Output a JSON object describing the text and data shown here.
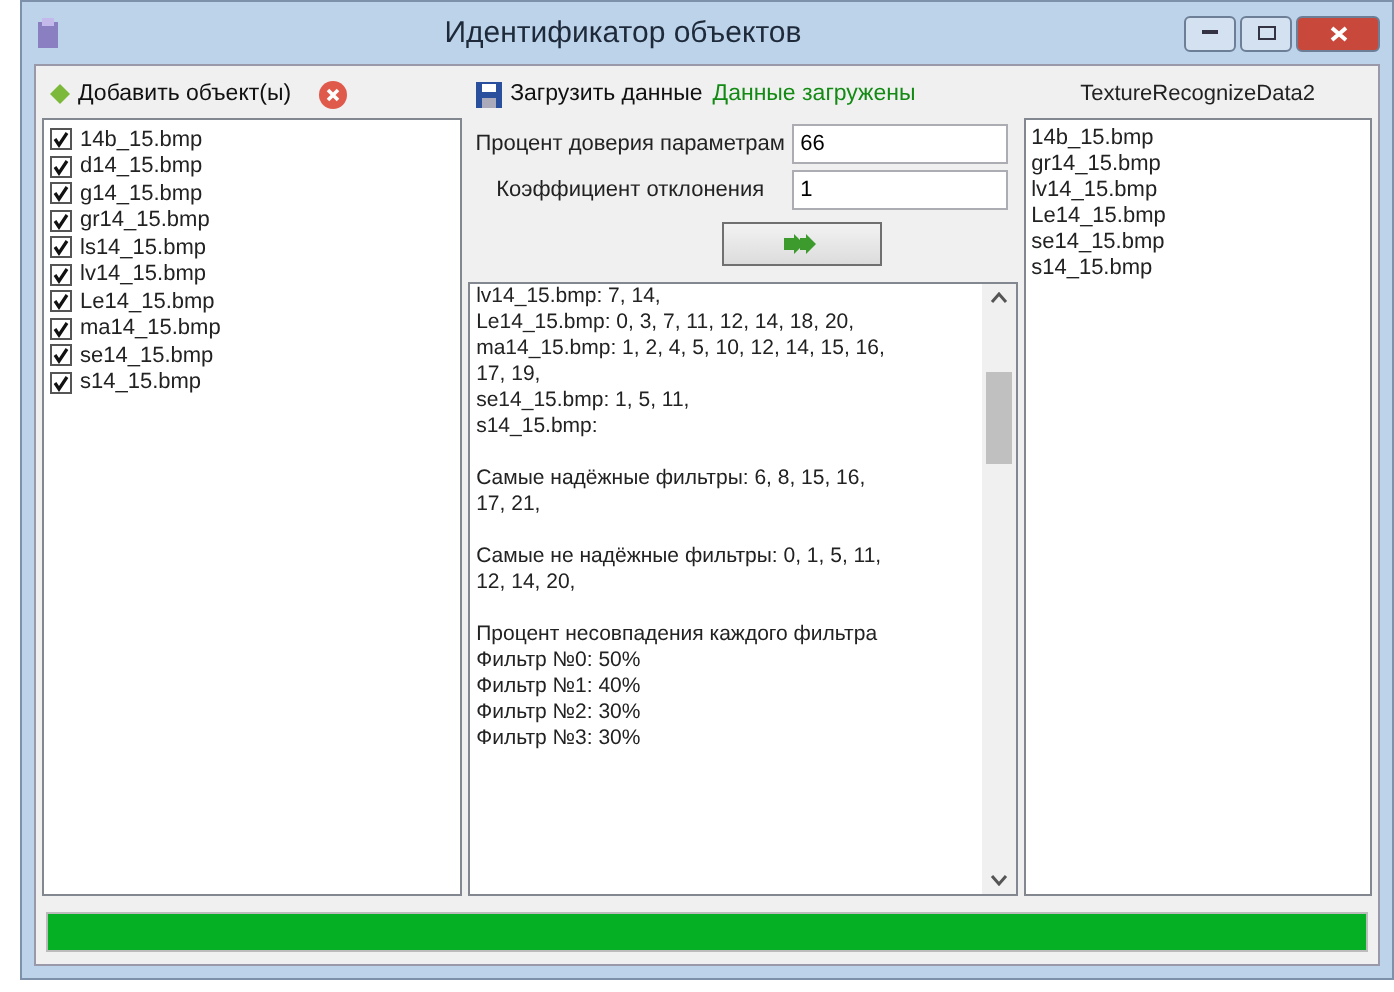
{
  "window": {
    "title": "Идентификатор объектов"
  },
  "objects_panel": {
    "add_button": "Добавить объект(ы)",
    "items": [
      {
        "label": "14b_15.bmp",
        "checked": true
      },
      {
        "label": "d14_15.bmp",
        "checked": true
      },
      {
        "label": "g14_15.bmp",
        "checked": true
      },
      {
        "label": "gr14_15.bmp",
        "checked": true
      },
      {
        "label": "ls14_15.bmp",
        "checked": true
      },
      {
        "label": "lv14_15.bmp",
        "checked": true
      },
      {
        "label": "Le14_15.bmp",
        "checked": true
      },
      {
        "label": "ma14_15.bmp",
        "checked": true
      },
      {
        "label": "se14_15.bmp",
        "checked": true
      },
      {
        "label": "s14_15.bmp",
        "checked": true
      }
    ]
  },
  "data_panel": {
    "load_button": "Загрузить данные",
    "status": "Данные загружены",
    "fields": [
      {
        "label": "Процент доверия параметрам",
        "value": "66"
      },
      {
        "label": "Коэффициент отклонения",
        "value": "1"
      }
    ],
    "output": [
      [
        "lv14_15.bmp: 7, 14,",
        "Le14_15.bmp: 0, 3, 7, 11, 12, 14, 18, 20,",
        "ma14_15.bmp: 1, 2, 4, 5, 10, 12, 14, 15, 16,",
        "17, 19,",
        "se14_15.bmp: 1, 5, 11,",
        "s14_15.bmp:"
      ],
      [
        "Самые надёжные фильтры: 6, 8, 15, 16,",
        "17, 21,"
      ],
      [
        "Самые не надёжные фильтры: 0, 1, 5, 11,",
        "12, 14, 20,"
      ],
      [
        "Процент несовпадения каждого фильтра",
        "Фильтр №0: 50%",
        "Фильтр №1: 40%",
        "Фильтр №2: 30%",
        "Фильтр №3: 30%"
      ]
    ]
  },
  "results_panel": {
    "title": "TextureRecognizeData2",
    "items": [
      "14b_15.bmp",
      "gr14_15.bmp",
      "lv14_15.bmp",
      "Le14_15.bmp",
      "se14_15.bmp",
      "s14_15.bmp"
    ]
  },
  "progress": {
    "level": 1
  }
}
